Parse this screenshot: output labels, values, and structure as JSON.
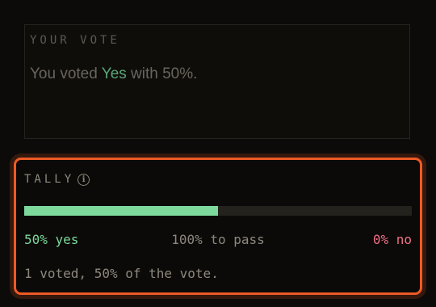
{
  "your_vote": {
    "heading": "YOUR VOTE",
    "prefix": "You voted ",
    "choice": "Yes",
    "suffix": " with 50%."
  },
  "tally": {
    "heading": "TALLY",
    "info_icon": "info-icon",
    "progress_percent": 50,
    "yes_label": "50% yes",
    "pass_label": "100% to pass",
    "no_label": "0% no",
    "summary": "1 voted, 50% of the vote."
  },
  "colors": {
    "accent": "#ee5a25",
    "yes": "#7cd99b",
    "no": "#ef6f86",
    "choice": "#5aa579"
  }
}
